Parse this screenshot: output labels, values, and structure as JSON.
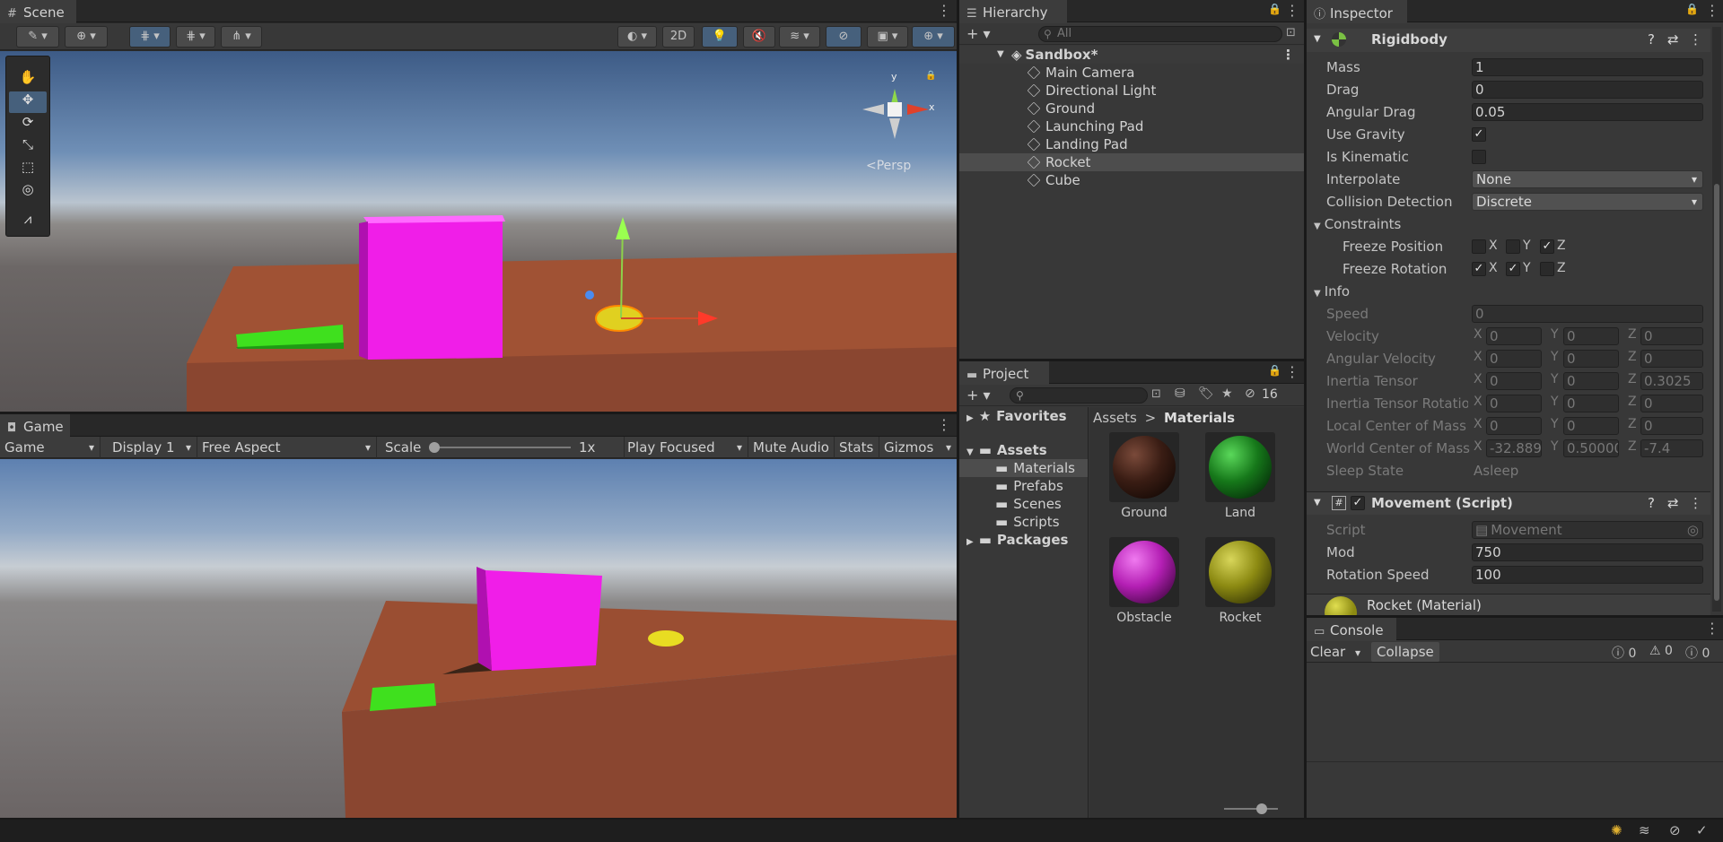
{
  "scene": {
    "tab_label": "Scene",
    "toolbar": {
      "mode_2d": "2D"
    },
    "gizmo": {
      "y_label": "y",
      "x_label": "x",
      "persp_label": "<Persp"
    }
  },
  "game": {
    "tab_label": "Game",
    "mode": "Game",
    "display": "Display 1",
    "aspect": "Free Aspect",
    "scale_label": "Scale",
    "scale_value": "1x",
    "play_focus": "Play Focused",
    "mute": "Mute Audio",
    "stats": "Stats",
    "gizmos": "Gizmos"
  },
  "hierarchy": {
    "tab_label": "Hierarchy",
    "search_placeholder": "All",
    "scene_name": "Sandbox*",
    "items": [
      "Main Camera",
      "Directional Light",
      "Ground",
      "Launching Pad",
      "Landing Pad",
      "Rocket",
      "Cube"
    ],
    "selected": "Rocket"
  },
  "project": {
    "tab_label": "Project",
    "hidden_count": "16",
    "favorites": "Favorites",
    "assets": "Assets",
    "folders": [
      "Materials",
      "Prefabs",
      "Scenes",
      "Scripts"
    ],
    "packages": "Packages",
    "breadcrumb": {
      "root": "Assets",
      "sep": ">",
      "current": "Materials"
    },
    "materials": [
      {
        "name": "Ground",
        "color": "#3a1d14"
      },
      {
        "name": "Land",
        "color": "#16781a"
      },
      {
        "name": "Obstacle",
        "color": "#b41fb4"
      },
      {
        "name": "Rocket",
        "color": "#8c8a12"
      }
    ]
  },
  "inspector": {
    "tab_label": "Inspector",
    "rigidbody": {
      "title": "Rigidbody",
      "mass_label": "Mass",
      "mass": "1",
      "drag_label": "Drag",
      "drag": "0",
      "angular_drag_label": "Angular Drag",
      "angular_drag": "0.05",
      "use_gravity_label": "Use Gravity",
      "use_gravity_check": "✓",
      "is_kinematic_label": "Is Kinematic",
      "interpolate_label": "Interpolate",
      "interpolate": "None",
      "collision_label": "Collision Detection",
      "collision": "Discrete",
      "constraints_label": "Constraints",
      "freeze_position_label": "Freeze Position",
      "freeze_rotation_label": "Freeze Rotation",
      "axis_x": "X",
      "axis_y": "Y",
      "axis_z": "Z",
      "check": "✓",
      "info_label": "Info",
      "speed_label": "Speed",
      "speed": "0",
      "velocity_label": "Velocity",
      "velocity": [
        "0",
        "0",
        "0"
      ],
      "angular_velocity_label": "Angular Velocity",
      "angular_velocity": [
        "0",
        "0",
        "0"
      ],
      "inertia_tensor_label": "Inertia Tensor",
      "inertia_tensor": [
        "0",
        "0",
        "0.3025"
      ],
      "inertia_rotation_label": "Inertia Tensor Rotation",
      "inertia_rotation": [
        "0",
        "0",
        "0"
      ],
      "local_com_label": "Local Center of Mass",
      "local_com": [
        "0",
        "0",
        "0"
      ],
      "world_com_label": "World Center of Mass",
      "world_com": [
        "-32.889",
        "0.50000",
        "-7.4"
      ],
      "sleep_state_label": "Sleep State",
      "sleep_state": "Asleep"
    },
    "movement": {
      "title": "Movement (Script)",
      "enabled_check": "✓",
      "script_label": "Script",
      "script": "Movement",
      "mod_label": "Mod",
      "mod": "750",
      "rotation_speed_label": "Rotation Speed",
      "rotation_speed": "100"
    },
    "material_header": "Rocket (Material)"
  },
  "console": {
    "tab_label": "Console",
    "clear": "Clear",
    "collapse": "Collapse",
    "log_count": "0",
    "warn_count": "0",
    "error_count": "0"
  },
  "colors": {
    "accent_blue": "#46607c",
    "obstacle": "#f01ee8",
    "land": "#2ed81e",
    "ground_pad": "#8a4630",
    "rocket": "#e0d020"
  }
}
